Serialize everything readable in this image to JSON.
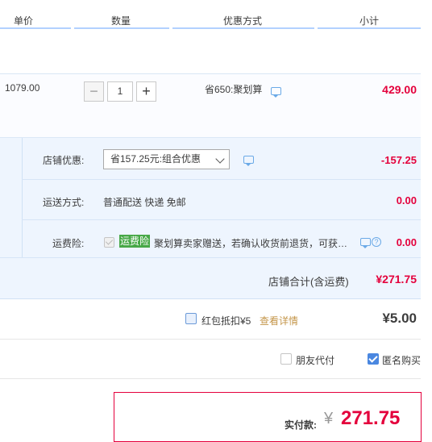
{
  "header": {
    "col_unit_price": "单价",
    "col_quantity": "数量",
    "col_discount": "优惠方式",
    "col_subtotal": "小计"
  },
  "item": {
    "unit_price": "1079.00",
    "quantity": "1",
    "minus": "−",
    "plus": "+",
    "promo": "省650:聚划算",
    "subtotal": "429.00"
  },
  "shop": {
    "discount_label": "店铺优惠:",
    "discount_select": "省157.25元:组合优惠",
    "discount_value": "-157.25",
    "shipping_label": "运送方式:",
    "shipping_text": "普通配送 快递 免邮",
    "shipping_value": "0.00",
    "insurance_label": "运费险:",
    "insurance_tag": "运费险",
    "insurance_text": "聚划算卖家赠送，若确认收货前退货，可获…",
    "insurance_value": "0.00",
    "total_label": "店铺合计(含运费)",
    "total_value": "¥271.75"
  },
  "redpacket": {
    "label": "红包抵扣¥5",
    "link": "查看详情",
    "value": "¥5.00"
  },
  "options": {
    "friend_pay": "朋友代付",
    "anonymous": "匿名购买"
  },
  "payment": {
    "label": "实付款:",
    "currency": "¥",
    "amount": "271.75"
  },
  "colors": {
    "accent_red": "#e4003c",
    "link_orange": "#c4964a",
    "tag_green": "#47a847",
    "header_line": "#b2d1ff"
  }
}
